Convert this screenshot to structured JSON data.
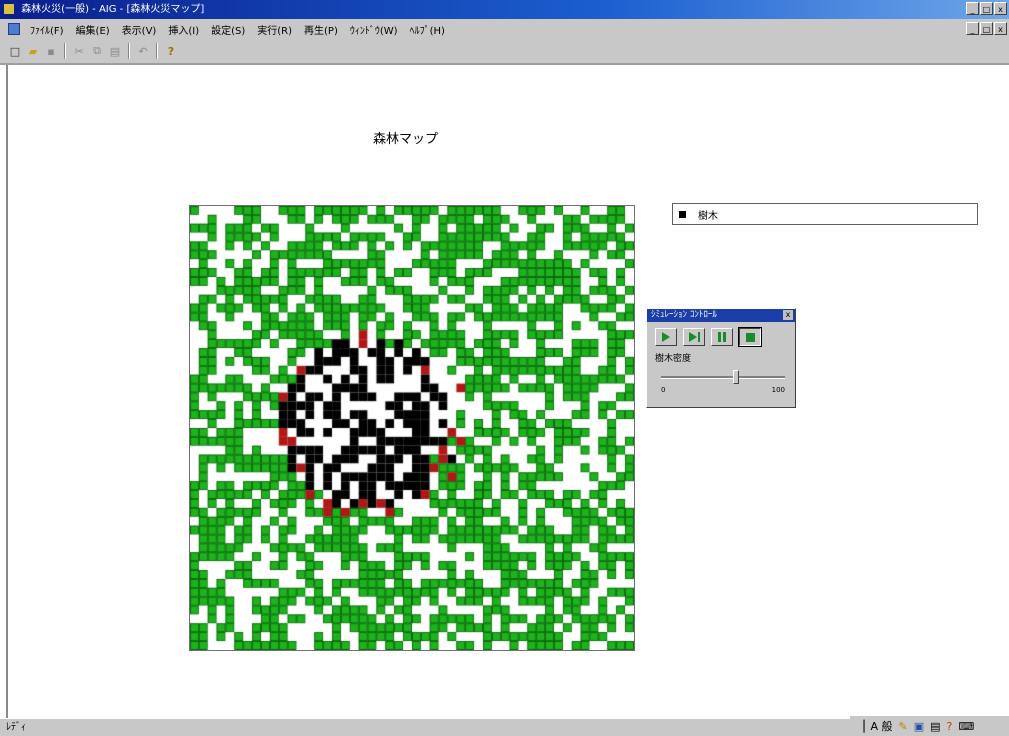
{
  "window": {
    "title": "森林火災(一般) - AIG - [森林火災マップ]",
    "minimize": "_",
    "maximize": "□",
    "close": "x"
  },
  "menubar": {
    "items": [
      "ﾌｧｲﾙ(F)",
      "編集(E)",
      "表示(V)",
      "挿入(I)",
      "設定(S)",
      "実行(R)",
      "再生(P)",
      "ｳｨﾝﾄﾞｳ(W)",
      "ﾍﾙﾌﾟ(H)"
    ]
  },
  "toolbar": {
    "buttons": [
      {
        "icon": "new-file-icon",
        "glyph": "□"
      },
      {
        "icon": "open-folder-icon",
        "glyph": "▰"
      },
      {
        "icon": "save-icon",
        "glyph": "▪"
      },
      {
        "icon": "cut-icon",
        "glyph": "✂"
      },
      {
        "icon": "copy-icon",
        "glyph": "⧉"
      },
      {
        "icon": "paste-icon",
        "glyph": "▤"
      },
      {
        "icon": "undo-icon",
        "glyph": "↶"
      },
      {
        "icon": "help-icon",
        "glyph": "?"
      }
    ]
  },
  "map": {
    "title": "森林マップ",
    "grid_size": 50,
    "colors": {
      "tree": "#1db31d",
      "burnt": "#000000",
      "fire": "#b01818",
      "grid_line": "#0b5a0b",
      "empty": "#ffffff"
    }
  },
  "legend": {
    "label": "樹木",
    "swatch_color": "#000000"
  },
  "control_palette": {
    "title": "ｼﾐｭﾚｰｼｮﾝ ｺﾝﾄﾛｰﾙ",
    "close": "x",
    "buttons": [
      {
        "name": "play-button",
        "icon": "play-icon"
      },
      {
        "name": "step-button",
        "icon": "step-icon"
      },
      {
        "name": "pause-button",
        "icon": "pause-icon"
      },
      {
        "name": "stop-button",
        "icon": "stop-icon"
      }
    ],
    "slider_label": "樹木密度",
    "slider_value": 0.6,
    "slider_min_label": "0",
    "slider_max_label": "100"
  },
  "statusbar": {
    "text": "ﾚﾃﾞｨ"
  },
  "tray": {
    "icons": [
      "ime-bar-icon",
      "ime-mode-icon",
      "pen-icon",
      "dictionary-icon",
      "tools-icon",
      "help-icon",
      "keyboard-icon"
    ],
    "ime_text": "A 般"
  }
}
